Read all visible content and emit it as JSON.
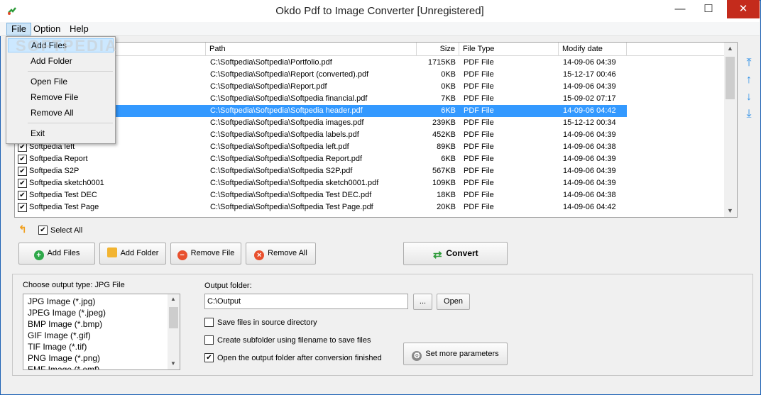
{
  "window": {
    "title": "Okdo Pdf to Image Converter [Unregistered]",
    "minimize": "—",
    "maximize": "☐",
    "close": "✕"
  },
  "menu": {
    "file": "File",
    "option": "Option",
    "help": "Help"
  },
  "file_menu": {
    "items": [
      "Add Files",
      "Add Folder",
      "Open File",
      "Remove File",
      "Remove All",
      "Exit"
    ]
  },
  "watermark": "SOFTPEDIA",
  "table": {
    "columns": [
      "Path",
      "Size",
      "File Type",
      "Modify date"
    ],
    "rows": [
      {
        "name": "",
        "path": "C:\\Softpedia\\Softpedia\\Portfolio.pdf",
        "size": "1715KB",
        "type": "PDF File",
        "date": "14-09-06 04:39"
      },
      {
        "name": "",
        "path": "C:\\Softpedia\\Softpedia\\Report (converted).pdf",
        "size": "0KB",
        "type": "PDF File",
        "date": "15-12-17 00:46"
      },
      {
        "name": "",
        "path": "C:\\Softpedia\\Softpedia\\Report.pdf",
        "size": "0KB",
        "type": "PDF File",
        "date": "14-09-06 04:39"
      },
      {
        "name": "",
        "path": "C:\\Softpedia\\Softpedia\\Softpedia financial.pdf",
        "size": "7KB",
        "type": "PDF File",
        "date": "15-09-02 07:17"
      },
      {
        "name": "",
        "path": "C:\\Softpedia\\Softpedia\\Softpedia header.pdf",
        "size": "6KB",
        "type": "PDF File",
        "date": "14-09-06 04:42"
      },
      {
        "name": "",
        "path": "C:\\Softpedia\\Softpedia\\Softpedia images.pdf",
        "size": "239KB",
        "type": "PDF File",
        "date": "15-12-12 00:34"
      },
      {
        "name": "",
        "path": "C:\\Softpedia\\Softpedia\\Softpedia labels.pdf",
        "size": "452KB",
        "type": "PDF File",
        "date": "14-09-06 04:39"
      },
      {
        "name": "Softpedia left",
        "path": "C:\\Softpedia\\Softpedia\\Softpedia left.pdf",
        "size": "89KB",
        "type": "PDF File",
        "date": "14-09-06 04:38"
      },
      {
        "name": "Softpedia Report",
        "path": "C:\\Softpedia\\Softpedia\\Softpedia Report.pdf",
        "size": "6KB",
        "type": "PDF File",
        "date": "14-09-06 04:39"
      },
      {
        "name": "Softpedia S2P",
        "path": "C:\\Softpedia\\Softpedia\\Softpedia S2P.pdf",
        "size": "567KB",
        "type": "PDF File",
        "date": "14-09-06 04:39"
      },
      {
        "name": "Softpedia sketch0001",
        "path": "C:\\Softpedia\\Softpedia\\Softpedia sketch0001.pdf",
        "size": "109KB",
        "type": "PDF File",
        "date": "14-09-06 04:39"
      },
      {
        "name": "Softpedia Test DEC",
        "path": "C:\\Softpedia\\Softpedia\\Softpedia Test DEC.pdf",
        "size": "18KB",
        "type": "PDF File",
        "date": "14-09-06 04:38"
      },
      {
        "name": "Softpedia Test Page",
        "path": "C:\\Softpedia\\Softpedia\\Softpedia Test Page.pdf",
        "size": "20KB",
        "type": "PDF File",
        "date": "14-09-06 04:42"
      }
    ]
  },
  "select_all": "Select All",
  "buttons": {
    "add_files": "Add Files",
    "add_folder": "Add Folder",
    "remove_file": "Remove File",
    "remove_all": "Remove All",
    "convert": "Convert"
  },
  "output": {
    "choose_label": "Choose output type:  JPG File",
    "formats": [
      "JPG Image (*.jpg)",
      "JPEG Image (*.jpeg)",
      "BMP Image (*.bmp)",
      "GIF Image (*.gif)",
      "TIF Image (*.tif)",
      "PNG Image (*.png)",
      "EMF Image (*.emf)"
    ],
    "folder_label": "Output folder:",
    "folder_value": "C:\\Output",
    "browse": "...",
    "open": "Open",
    "opt_source": "Save files in source directory",
    "opt_subfolder": "Create subfolder using filename to save files",
    "opt_open_after": "Open the output folder after conversion finished",
    "more_params": "Set more parameters"
  },
  "colors": {
    "selection": "#3399ff",
    "accent": "#2a8ee6"
  }
}
